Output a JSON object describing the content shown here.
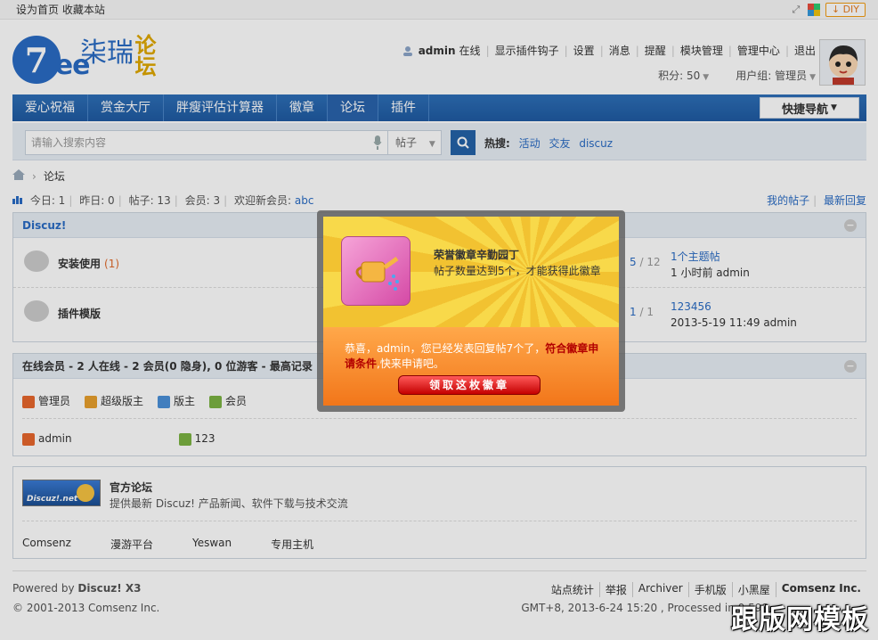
{
  "topbar": {
    "set_home": "设为首页",
    "bookmark": "收藏本站",
    "diy": "DIY"
  },
  "logo": {
    "seven": "7",
    "tree": "ree",
    "cn_main": "柒瑞",
    "cn_side": "论坛"
  },
  "usernav": {
    "username": "admin",
    "status": "在线",
    "links": [
      "显示插件钩子",
      "设置",
      "消息",
      "提醒",
      "模块管理",
      "管理中心",
      "退出"
    ],
    "points": "积分: 50",
    "group": "用户组: 管理员"
  },
  "nav": {
    "items": [
      "爱心祝福",
      "赏金大厅",
      "胖瘦评估计算器",
      "徽章",
      "论坛",
      "插件"
    ],
    "active": "论坛",
    "quick_nav": "快捷导航"
  },
  "search": {
    "placeholder": "请输入搜索内容",
    "type": "帖子",
    "hot_label": "热搜:",
    "hot_keywords": [
      "活动",
      "交友",
      "discuz"
    ]
  },
  "breadcrumb": {
    "current": "论坛"
  },
  "stats": {
    "today": "今日: 1",
    "yesterday": "昨日: 0",
    "posts": "帖子: 13",
    "members": "会员: 3",
    "welcome": "欢迎新会员:",
    "new_member": "abc",
    "my_posts": "我的帖子",
    "latest_replies": "最新回复"
  },
  "forum_box": {
    "title": "Discuz!",
    "forums": [
      {
        "name": "安装使用",
        "count": "(1)",
        "counts_a": "5",
        "counts_b": "12",
        "last_title": "1个主题帖",
        "last_info": "1 小时前 admin"
      },
      {
        "name": "插件模版",
        "count": "",
        "counts_a": "1",
        "counts_b": "1",
        "last_title": "123456",
        "last_info": "2013-5-19 11:49 admin"
      }
    ]
  },
  "online_box": {
    "title": "在线会员 - 2 人在线 - 2 会员(0 隐身), 0 位游客 - 最高记录",
    "legend": [
      {
        "label": "管理员",
        "color": "#e8672d"
      },
      {
        "label": "超级版主",
        "color": "#e8a02d"
      },
      {
        "label": "版主",
        "color": "#4a90d9"
      },
      {
        "label": "会员",
        "color": "#7cb342"
      }
    ],
    "users": [
      {
        "name": "admin",
        "color": "#e8672d"
      },
      {
        "name": "123",
        "color": "#7cb342"
      }
    ]
  },
  "partner_box": {
    "logo_text": "Discuz!.net",
    "title": "官方论坛",
    "desc": "提供最新 Discuz! 产品新闻、软件下载与技术交流",
    "links": [
      "Comsenz",
      "漫游平台",
      "Yeswan",
      "专用主机"
    ]
  },
  "footer": {
    "powered_prefix": "Powered by",
    "powered_product": "Discuz! X3",
    "copyright": "© 2001-2013 Comsenz Inc.",
    "links": [
      "站点统计",
      "举报",
      "Archiver",
      "手机版",
      "小黑屋",
      "Comsenz Inc."
    ],
    "gmt": "GMT+8, 2013-6-24 15:20 , Processed in 0.598"
  },
  "modal": {
    "badge_title": "荣誉徽章辛勤园丁",
    "badge_desc": "帖子数量达到5个，才能获得此徽章",
    "congrats_text": "恭喜，admin，您已经发表回复帖7个了，",
    "congrats_red": "符合徽章申请条件",
    "congrats_tail": ",快来申请吧。",
    "claim_button": "领取这枚徽章"
  },
  "watermark": "跟版网模板"
}
